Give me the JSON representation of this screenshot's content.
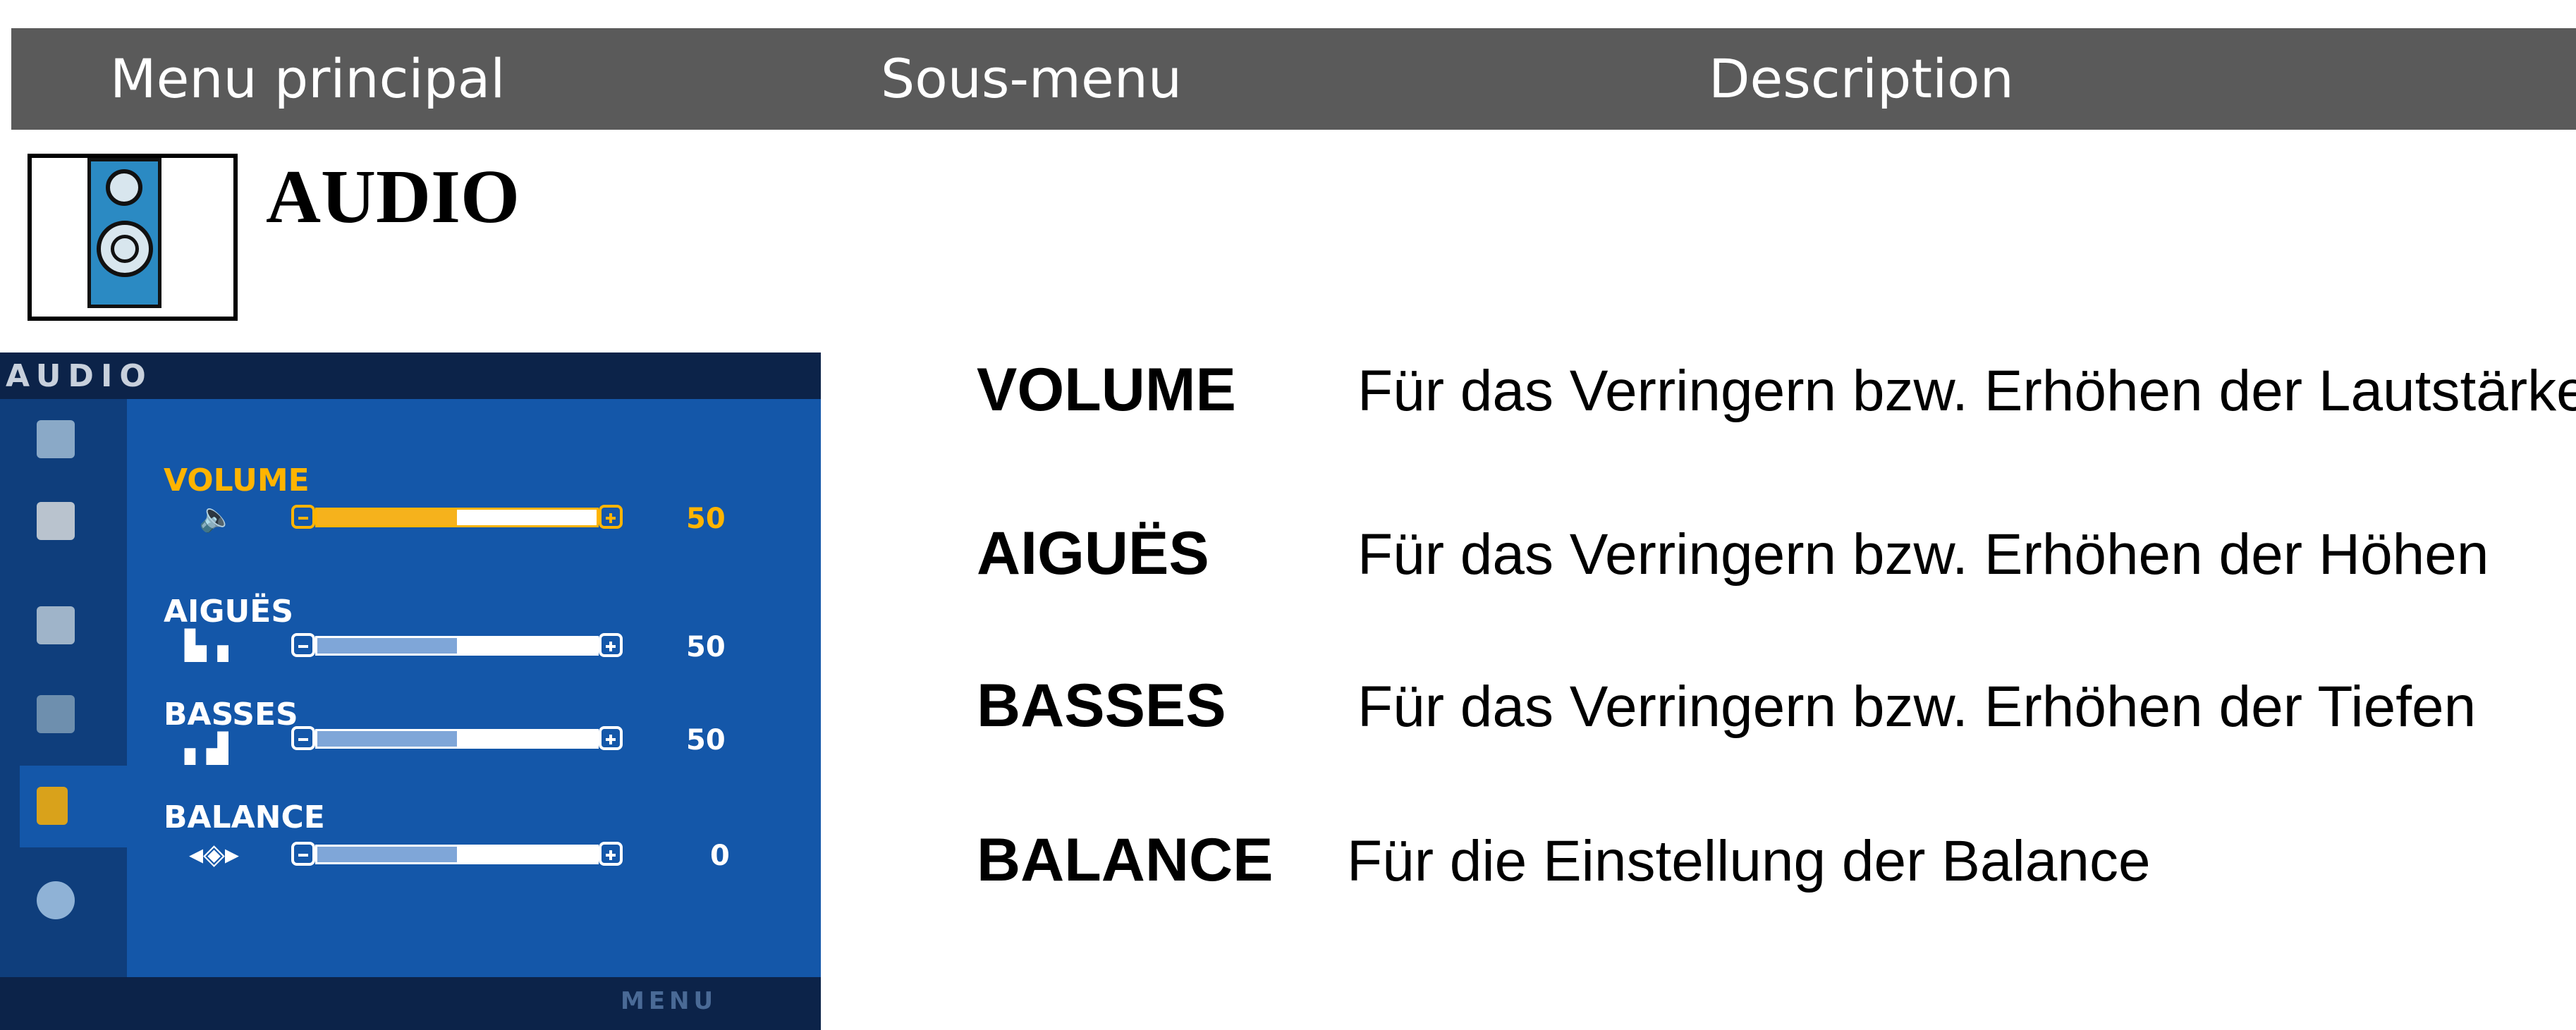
{
  "header": {
    "col_main": "Menu principal",
    "col_sub": "Sous-menu",
    "col_desc": "Description"
  },
  "section": {
    "title": "AUDIO",
    "icon": "speaker-icon"
  },
  "osd": {
    "title": "AUDIO",
    "menu_label": "MENU",
    "sidebar_icons": [
      "picture-icon",
      "color-icon",
      "tracking-icon",
      "setup-icon",
      "speaker-icon",
      "special-icon"
    ],
    "active_sidebar_index": 4,
    "items": [
      {
        "label": "VOLUME",
        "value": "50",
        "level": 0.5,
        "icon": "speaker-sound-icon",
        "glyph": "🔈",
        "highlighted": true
      },
      {
        "label": "AIGUËS",
        "value": "50",
        "level": 0.5,
        "icon": "treble-icon",
        "glyph": "▙▗",
        "highlighted": false
      },
      {
        "label": "BASSES",
        "value": "50",
        "level": 0.5,
        "icon": "bass-icon",
        "glyph": "▖▟",
        "highlighted": false
      },
      {
        "label": "BALANCE",
        "value": "0",
        "level": 0.5,
        "icon": "balance-icon",
        "glyph": "◂◈▸",
        "highlighted": false
      }
    ]
  },
  "descriptions": [
    {
      "name": "VOLUME",
      "text": "Für das Verringern bzw. Erhöhen der Lautstärke"
    },
    {
      "name": "AIGUËS",
      "text": "Für das Verringern bzw. Erhöhen der Höhen"
    },
    {
      "name": "BASSES",
      "text": "Für das Verringern bzw. Erhöhen der Tiefen"
    },
    {
      "name": "BALANCE",
      "text": "Für die Einstellung der Balance"
    }
  ],
  "colors": {
    "header_bg": "#5a5a5a",
    "osd_bg": "#1457a9",
    "osd_dark": "#0c2349",
    "highlight": "#ffb400",
    "speaker_blue": "#2b8ac3"
  }
}
